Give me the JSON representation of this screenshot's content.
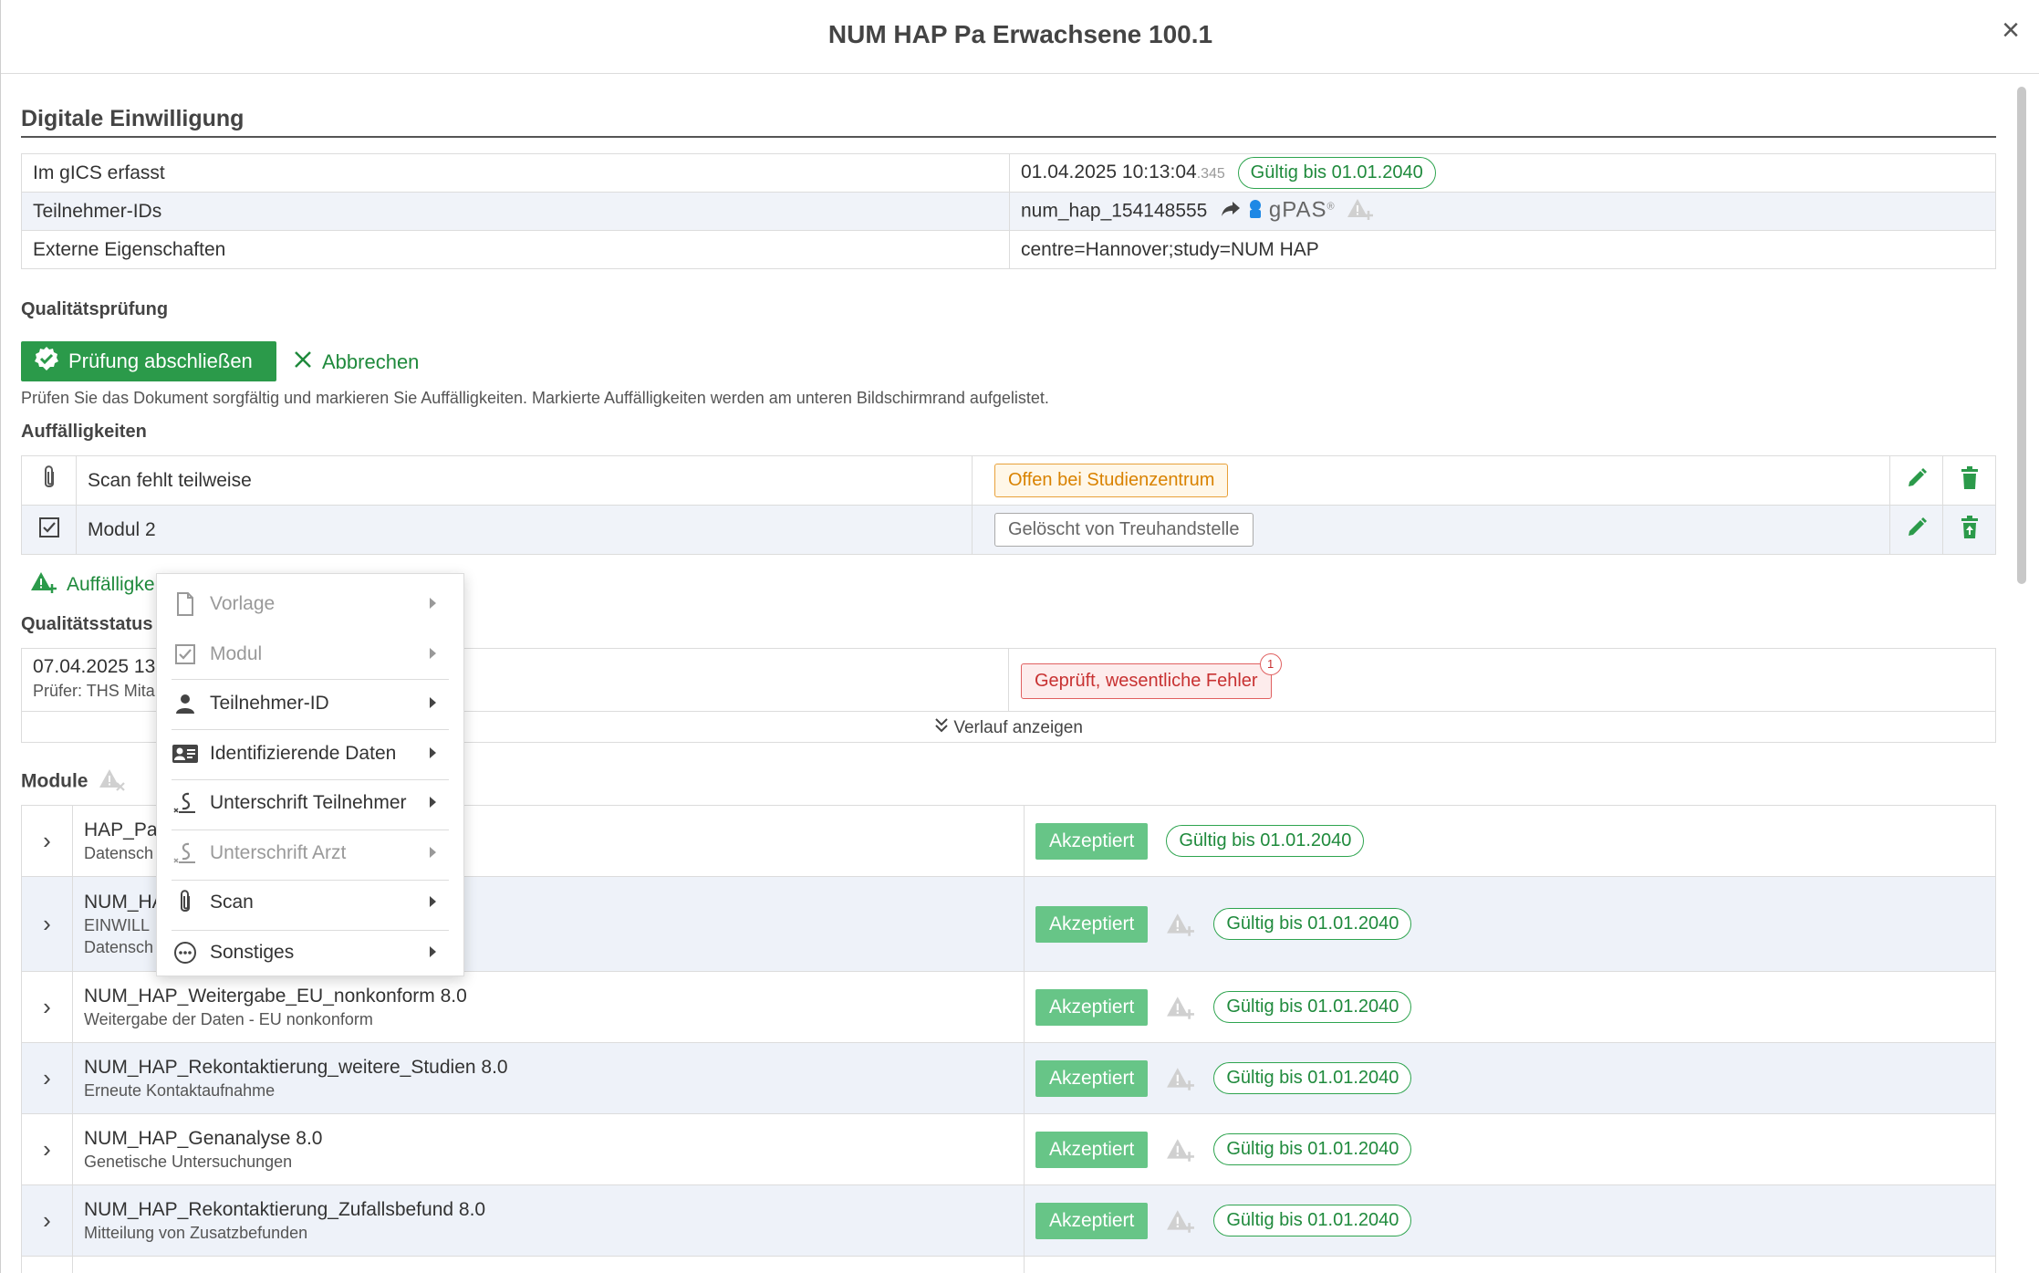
{
  "dialog": {
    "title": "NUM HAP Pa Erwachsene 100.1",
    "close_label": "×"
  },
  "consent": {
    "title": "Digitale Einwilligung",
    "rows": [
      {
        "label": "Im gICS erfasst",
        "value": "01.04.2025 10:13:04",
        "ms": ".345",
        "badge": "Gültig bis 01.01.2040"
      },
      {
        "label": "Teilnehmer-IDs",
        "value": "num_hap_154148555",
        "service": "gPAS",
        "service_sup": "®"
      },
      {
        "label": "Externe Eigenschaften",
        "value": "centre=Hannover;study=NUM HAP"
      }
    ]
  },
  "quality_check": {
    "title": "Qualitätsprüfung",
    "finish_button": "Prüfung abschließen",
    "cancel_button": "Abbrechen",
    "hint": "Prüfen Sie das Dokument sorgfältig und markieren Sie Auffälligkeiten. Markierte Auffälligkeiten werden am unteren Bildschirmrand aufgelistet.",
    "issues_title": "Auffälligkeiten",
    "issues": [
      {
        "icon": "paperclip-icon",
        "label": "Scan fehlt teilweise",
        "status": "Offen bei Studienzentrum"
      },
      {
        "icon": "checkbox-icon",
        "label": "Modul 2",
        "status": "Gelöscht von Treuhandstelle"
      }
    ],
    "add_issue_label": "Auffälligke"
  },
  "quality_status": {
    "title": "Qualitätsstatus",
    "date": "07.04.2025 13",
    "pruefer": "Prüfer: THS Mita",
    "status": "Geprüft, wesentliche Fehler",
    "status_badge": "1",
    "history_label": "Verlauf anzeigen"
  },
  "modules": {
    "title": "Module",
    "rows": [
      {
        "name": "HAP_Pa",
        "desc": "Datensch",
        "status": "Akzeptiert",
        "validity": "Gültig bis 01.01.2040",
        "warn": false
      },
      {
        "name": "NUM_HA",
        "desc": "EINWILL",
        "desc2": "Datensch",
        "status": "Akzeptiert",
        "validity": "Gültig bis 01.01.2040",
        "warn": true
      },
      {
        "name": "NUM_HAP_Weitergabe_EU_nonkonform 8.0",
        "desc": "Weitergabe der Daten - EU nonkonform",
        "status": "Akzeptiert",
        "validity": "Gültig bis 01.01.2040",
        "warn": true
      },
      {
        "name": "NUM_HAP_Rekontaktierung_weitere_Studien 8.0",
        "desc": "Erneute Kontaktaufnahme",
        "status": "Akzeptiert",
        "validity": "Gültig bis 01.01.2040",
        "warn": true
      },
      {
        "name": "NUM_HAP_Genanalyse 8.0",
        "desc": "Genetische Untersuchungen",
        "status": "Akzeptiert",
        "validity": "Gültig bis 01.01.2040",
        "warn": true
      },
      {
        "name": "NUM_HAP_Rekontaktierung_Zufallsbefund 8.0",
        "desc": "Mitteilung von Zusatzbefunden",
        "status": "Akzeptiert",
        "validity": "Gültig bis 01.01.2040",
        "warn": true
      }
    ]
  },
  "context_menu": {
    "items": [
      {
        "label": "Vorlage",
        "icon": "document-icon",
        "disabled": true
      },
      {
        "label": "Modul",
        "icon": "checkbox-icon",
        "disabled": true
      },
      {
        "label": "Teilnehmer-ID",
        "icon": "person-icon",
        "disabled": false
      },
      {
        "label": "Identifizierende Daten",
        "icon": "id-card-icon",
        "disabled": false
      },
      {
        "label": "Unterschrift Teilnehmer",
        "icon": "signature-icon",
        "disabled": false
      },
      {
        "label": "Unterschrift Arzt",
        "icon": "signature-icon",
        "disabled": true
      },
      {
        "label": "Scan",
        "icon": "paperclip-icon",
        "disabled": false
      },
      {
        "label": "Sonstiges",
        "icon": "more-circle-icon",
        "disabled": false
      }
    ]
  },
  "colors": {
    "accent_green": "#2b9a4a",
    "accept_green": "#67c587",
    "warn_orange": "#d98200",
    "error_red": "#c83232"
  }
}
